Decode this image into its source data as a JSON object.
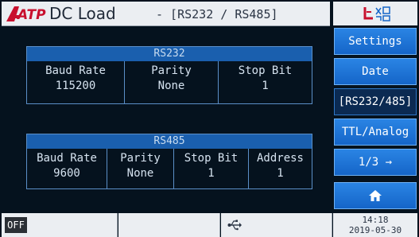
{
  "header": {
    "logo_text": "ATP",
    "title": "DC Load",
    "subtitle": "- [RS232 / RS485]"
  },
  "side_menu": [
    {
      "label": "Settings",
      "active": false
    },
    {
      "label": "Date",
      "active": false
    },
    {
      "label": "[RS232/485]",
      "active": true
    },
    {
      "label": "TTL/Analog",
      "active": false
    },
    {
      "label": "1/3 →",
      "active": false
    },
    {
      "label": "home-icon",
      "active": false
    }
  ],
  "rs232": {
    "title": "RS232",
    "columns": [
      {
        "label": "Baud Rate",
        "value": "115200"
      },
      {
        "label": "Parity",
        "value": "None"
      },
      {
        "label": "Stop Bit",
        "value": "1"
      }
    ]
  },
  "rs485": {
    "title": "RS485",
    "columns": [
      {
        "label": "Baud Rate",
        "value": "9600"
      },
      {
        "label": "Parity",
        "value": "None"
      },
      {
        "label": "Stop Bit",
        "value": "1"
      },
      {
        "label": "Address",
        "value": "1"
      }
    ]
  },
  "status_bar": {
    "output_state": "OFF",
    "time": "14:18",
    "date": "2019-05-30"
  },
  "colors": {
    "screen_bg": "#05121e",
    "button_blue": "#1f78dc",
    "table_header": "#1a5fae",
    "logo_red": "#c8102e"
  }
}
